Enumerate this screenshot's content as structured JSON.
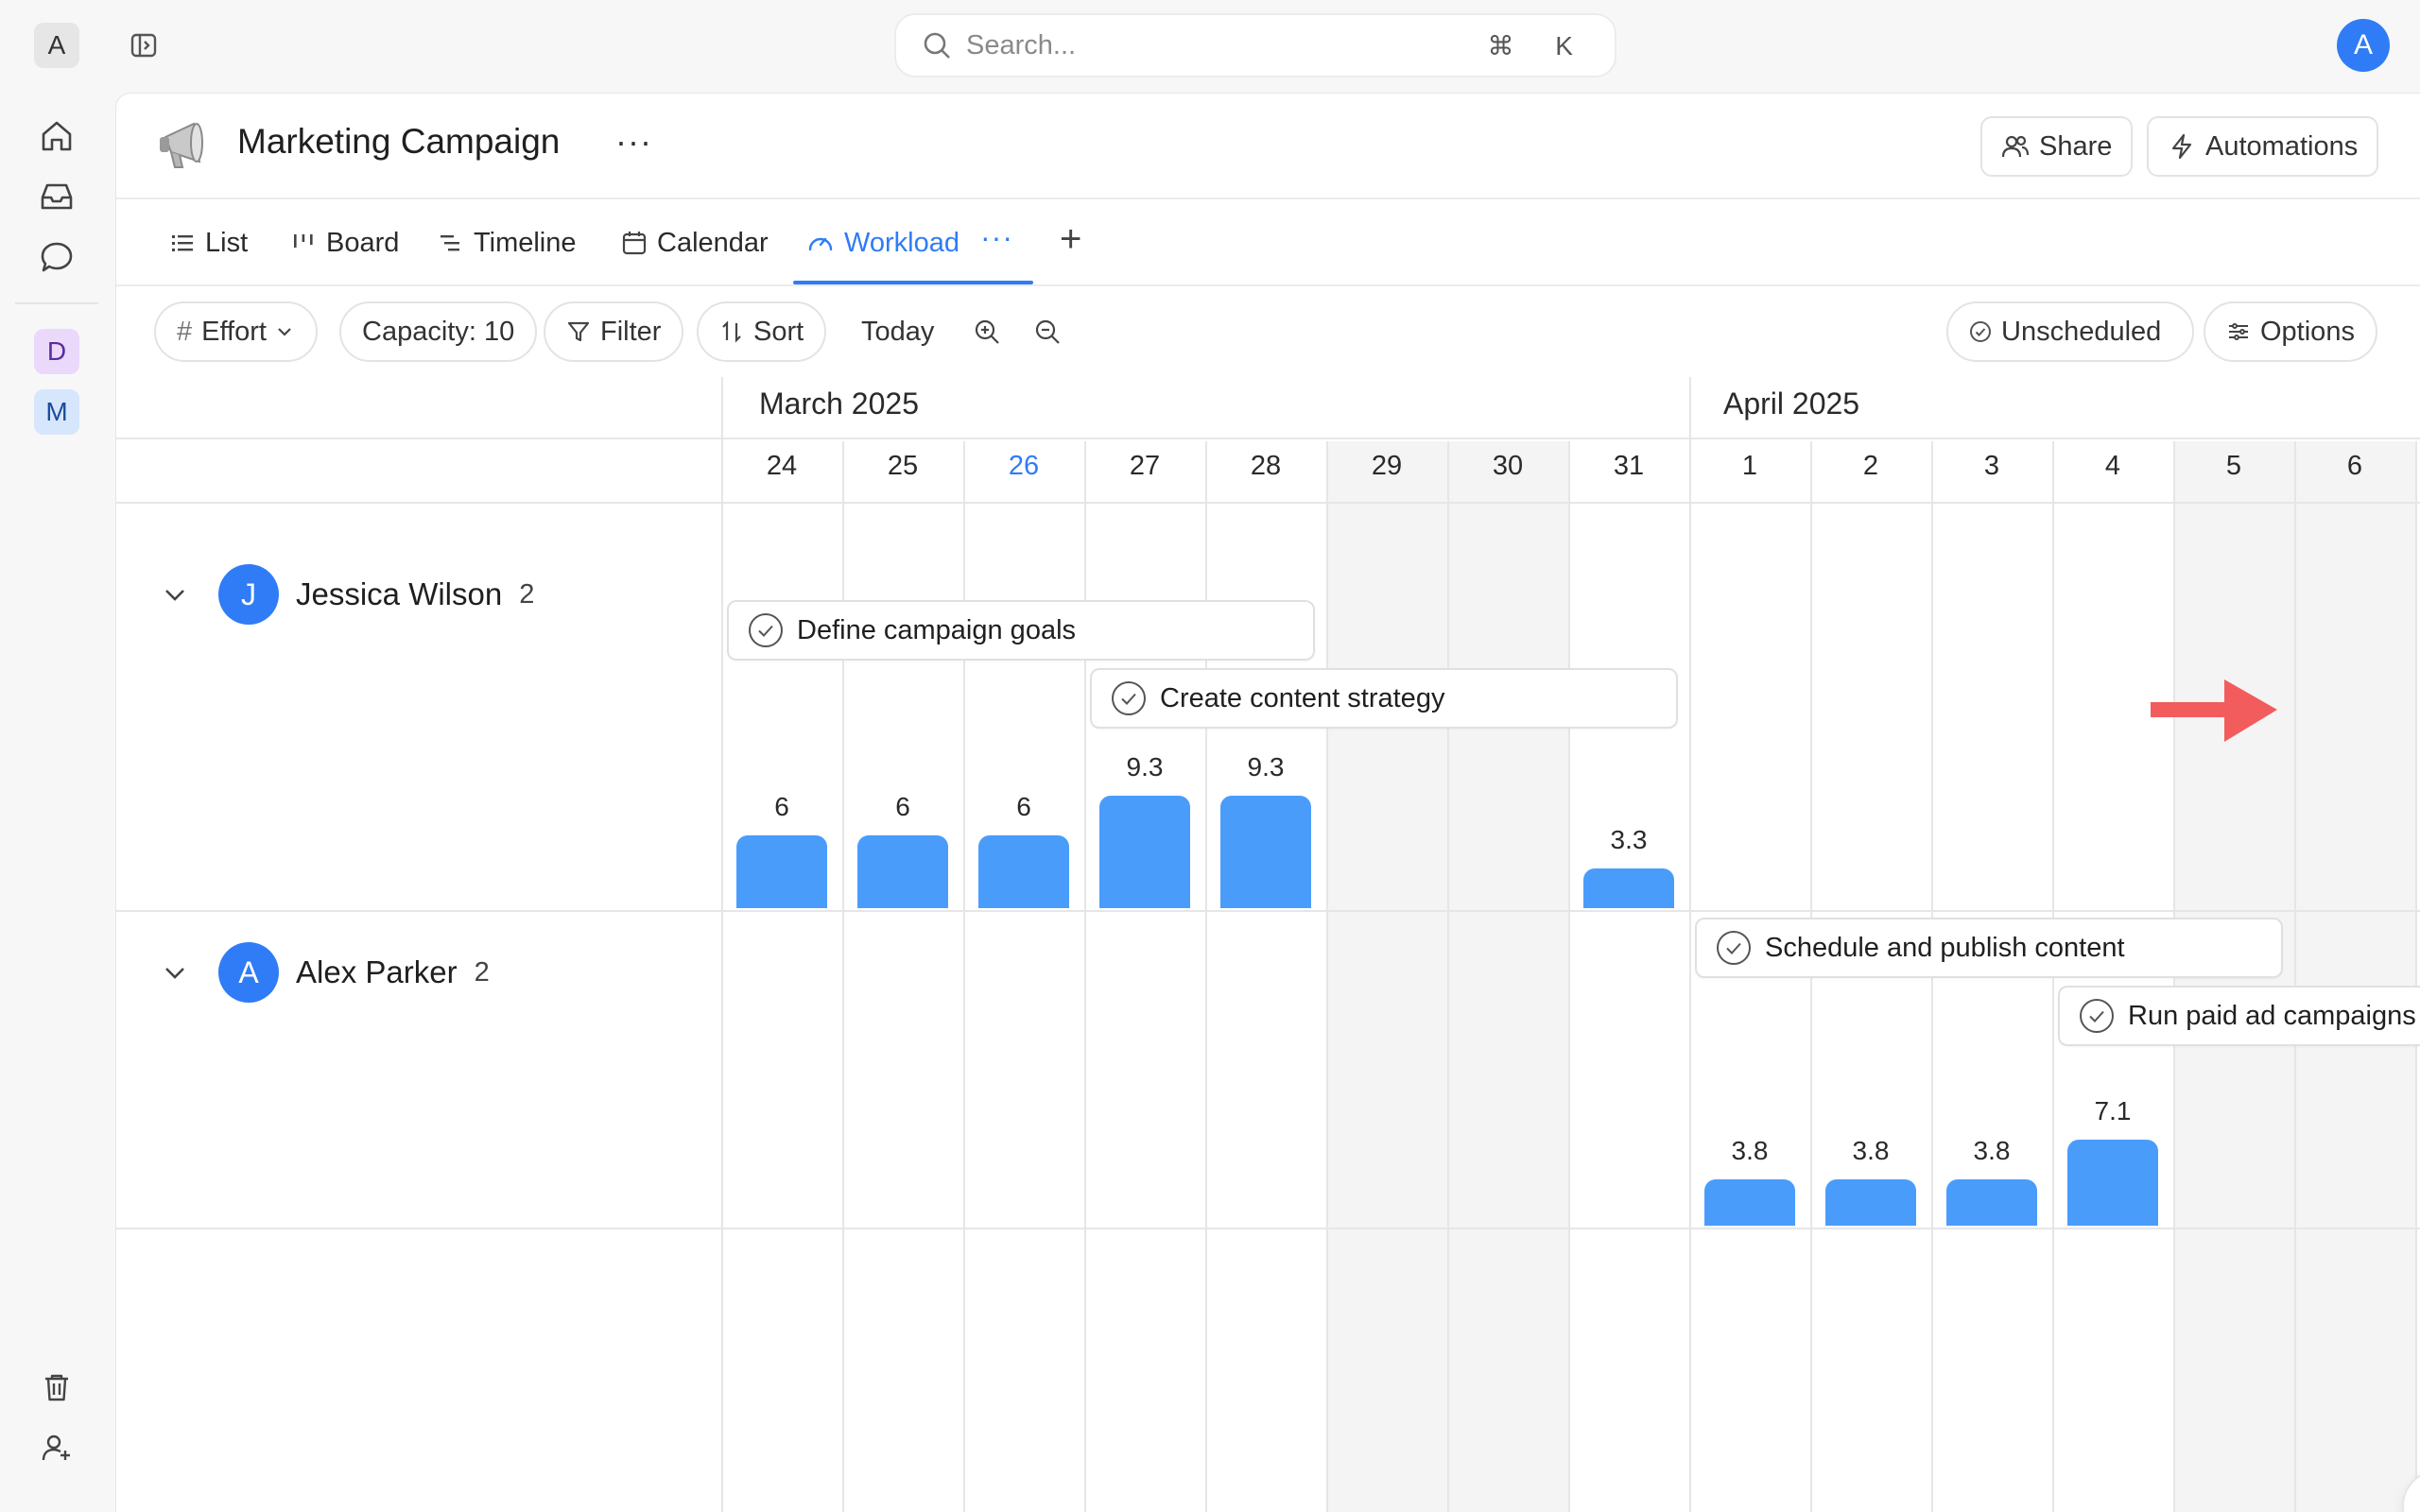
{
  "workspace": {
    "initial": "A"
  },
  "search": {
    "placeholder": "Search...",
    "shortcut": "⌘ K"
  },
  "user": {
    "initial": "A"
  },
  "spaces": [
    {
      "initial": "D",
      "color": "#ead9fb"
    },
    {
      "initial": "M",
      "color": "#d6e6fd"
    }
  ],
  "project": {
    "title": "Marketing Campaign",
    "more": "···"
  },
  "header_actions": {
    "share": "Share",
    "automations": "Automations"
  },
  "tabs": [
    {
      "label": "List",
      "icon": "list-icon"
    },
    {
      "label": "Board",
      "icon": "board-icon"
    },
    {
      "label": "Timeline",
      "icon": "timeline-icon"
    },
    {
      "label": "Calendar",
      "icon": "calendar-icon"
    },
    {
      "label": "Workload",
      "icon": "gauge-icon",
      "active": true
    }
  ],
  "tab_more": "···",
  "tab_add": "+",
  "toolbar": {
    "effort": "Effort",
    "capacity": "Capacity: 10",
    "filter": "Filter",
    "sort": "Sort",
    "today": "Today",
    "unscheduled": "Unscheduled",
    "options": "Options"
  },
  "timeline": {
    "months": [
      "March 2025",
      "April 2025"
    ],
    "days": [
      "24",
      "25",
      "26",
      "27",
      "28",
      "29",
      "30",
      "31",
      "1",
      "2",
      "3",
      "4",
      "5",
      "6"
    ],
    "today_index": 2,
    "weekend_indices": [
      5,
      6,
      12,
      13
    ]
  },
  "people": [
    {
      "initial": "J",
      "name": "Jessica Wilson",
      "count": "2",
      "tasks": [
        "Define campaign goals",
        "Create content strategy"
      ],
      "workload": [
        {
          "day_index": 0,
          "label": "6",
          "value": 6
        },
        {
          "day_index": 1,
          "label": "6",
          "value": 6
        },
        {
          "day_index": 2,
          "label": "6",
          "value": 6
        },
        {
          "day_index": 3,
          "label": "9.3",
          "value": 9.3
        },
        {
          "day_index": 4,
          "label": "9.3",
          "value": 9.3
        },
        {
          "day_index": 7,
          "label": "3.3",
          "value": 3.3
        }
      ]
    },
    {
      "initial": "A",
      "name": "Alex Parker",
      "count": "2",
      "tasks": [
        "Schedule and publish content",
        "Run paid ad campaigns"
      ],
      "workload": [
        {
          "day_index": 8,
          "label": "3.8",
          "value": 3.8
        },
        {
          "day_index": 9,
          "label": "3.8",
          "value": 3.8
        },
        {
          "day_index": 10,
          "label": "3.8",
          "value": 3.8
        },
        {
          "day_index": 11,
          "label": "7.1",
          "value": 7.1
        }
      ]
    }
  ],
  "colors": {
    "accent": "#2f7cf6",
    "bar": "#4a9cfb",
    "callout": "#f25c5c"
  }
}
